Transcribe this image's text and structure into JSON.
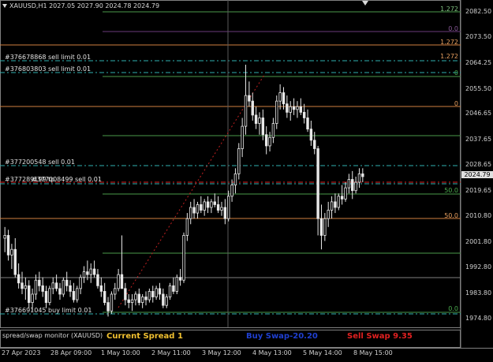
{
  "window": {
    "symbol_line": "XAUUSD,H1  2027.05 2027.90 2024.78 2024.79"
  },
  "orders": [
    {
      "label": "#376678868 sell limit 0.01"
    },
    {
      "label": "#376803803 sell limit 0.01"
    },
    {
      "label": "#377200548 sell 0.01"
    },
    {
      "label": "#377289199 tp"
    },
    {
      "label": "#377008499 sell 0.01"
    },
    {
      "label": "#376691045 buy limit 0.01"
    }
  ],
  "fib_levels": [
    {
      "text": "1.272",
      "color": "#7fbf7f"
    },
    {
      "text": "0.0",
      "color": "#8a5a9a"
    },
    {
      "text": "1.272",
      "color": "#e8a060"
    },
    {
      "text": "1.272",
      "color": "#e8a060"
    },
    {
      "text": "0",
      "color": "#4caf50"
    },
    {
      "text": "0",
      "color": "#e8a060"
    },
    {
      "text": "50.0",
      "color": "#4caf50"
    },
    {
      "text": "50.0",
      "color": "#e8a060"
    },
    {
      "text": "0.0",
      "color": "#4caf50"
    }
  ],
  "price_axis": [
    "2082.50",
    "2073.50",
    "2064.25",
    "2055.50",
    "2046.65",
    "2037.65",
    "2028.65",
    "2019.65",
    "2010.80",
    "2001.80",
    "1992.80",
    "1983.80",
    "1974.80"
  ],
  "current_price": "2024.79",
  "time_axis": [
    "27 Apr 2023",
    "28 Apr 09:00",
    "1 May 10:00",
    "2 May 11:00",
    "3 May 12:00",
    "4 May 13:00",
    "5 May 14:00",
    "8 May 15:00"
  ],
  "subwindow": {
    "title": "spread/swap monitor (XAUUSD)",
    "spread_label": "Current Spread 1",
    "buy_swap_label": "Buy Swap-20.20",
    "sell_swap_label": "Sell Swap 9.35",
    "spread_color": "#f0c030",
    "buy_color": "#1f3fd0",
    "sell_color": "#e02020"
  },
  "chart_data": {
    "type": "candlestick",
    "symbol": "XAUUSD",
    "timeframe": "H1",
    "ylim": [
      1972,
      2087
    ],
    "ohlc": [
      [
        2003,
        2007,
        1998,
        2004
      ],
      [
        2004,
        2006,
        1995,
        1997
      ],
      [
        1997,
        2001,
        1992,
        1999
      ],
      [
        1999,
        2003,
        1989,
        1990
      ],
      [
        1990,
        1994,
        1985,
        1987
      ],
      [
        1987,
        1991,
        1983,
        1985
      ],
      [
        1985,
        1989,
        1981,
        1986
      ],
      [
        1986,
        1988,
        1978,
        1980
      ],
      [
        1980,
        1985,
        1977,
        1983
      ],
      [
        1983,
        1990,
        1981,
        1988
      ],
      [
        1988,
        1991,
        1984,
        1986
      ],
      [
        1986,
        1989,
        1982,
        1984
      ],
      [
        1984,
        1986,
        1978,
        1980
      ],
      [
        1980,
        1986,
        1979,
        1985
      ],
      [
        1985,
        1989,
        1983,
        1987
      ],
      [
        1987,
        1990,
        1984,
        1985
      ],
      [
        1985,
        1987,
        1981,
        1983
      ],
      [
        1983,
        1989,
        1982,
        1988
      ],
      [
        1988,
        1991,
        1984,
        1986
      ],
      [
        1986,
        1988,
        1982,
        1984
      ],
      [
        1984,
        1987,
        1980,
        1981
      ],
      [
        1981,
        1986,
        1980,
        1985
      ],
      [
        1985,
        1990,
        1983,
        1989
      ],
      [
        1989,
        1993,
        1987,
        1991
      ],
      [
        1991,
        1995,
        1988,
        1990
      ],
      [
        1990,
        1994,
        1987,
        1992
      ],
      [
        1992,
        1995,
        1989,
        1990
      ],
      [
        1990,
        1992,
        1985,
        1986
      ],
      [
        1986,
        1989,
        1982,
        1984
      ],
      [
        1984,
        1987,
        1979,
        1980
      ],
      [
        1980,
        1982,
        1975,
        1977
      ],
      [
        1977,
        1984,
        1976,
        1983
      ],
      [
        1983,
        1987,
        1981,
        1985
      ],
      [
        1985,
        1992,
        1984,
        1990
      ],
      [
        1990,
        2004,
        1989,
        1985
      ],
      [
        1985,
        1987,
        1979,
        1981
      ],
      [
        1981,
        1983,
        1978,
        1980
      ],
      [
        1980,
        1983,
        1977,
        1981
      ],
      [
        1981,
        1984,
        1979,
        1983
      ],
      [
        1983,
        1985,
        1979,
        1980
      ],
      [
        1980,
        1983,
        1978,
        1982
      ],
      [
        1982,
        1984,
        1979,
        1981
      ],
      [
        1981,
        1985,
        1980,
        1984
      ],
      [
        1984,
        1986,
        1980,
        1982
      ],
      [
        1982,
        1986,
        1981,
        1985
      ],
      [
        1985,
        1987,
        1981,
        1983
      ],
      [
        1983,
        1985,
        1978,
        1979
      ],
      [
        1979,
        1983,
        1978,
        1982
      ],
      [
        1982,
        1987,
        1981,
        1986
      ],
      [
        1986,
        1989,
        1983,
        1984
      ],
      [
        1984,
        1990,
        1983,
        1989
      ],
      [
        1989,
        1992,
        1986,
        1988
      ],
      [
        1988,
        2005,
        1987,
        2004
      ],
      [
        2004,
        2012,
        2002,
        2010
      ],
      [
        2010,
        2016,
        2008,
        2014
      ],
      [
        2014,
        2017,
        2010,
        2012
      ],
      [
        2012,
        2016,
        2010,
        2015
      ],
      [
        2015,
        2018,
        2012,
        2013
      ],
      [
        2013,
        2017,
        2011,
        2016
      ],
      [
        2016,
        2018,
        2012,
        2014
      ],
      [
        2014,
        2017,
        2012,
        2016
      ],
      [
        2016,
        2019,
        2014,
        2015
      ],
      [
        2015,
        2018,
        2012,
        2013
      ],
      [
        2013,
        2016,
        2011,
        2014
      ],
      [
        2014,
        2017,
        2008,
        2010
      ],
      [
        2010,
        2020,
        2009,
        2018
      ],
      [
        2018,
        2024,
        2016,
        2022
      ],
      [
        2022,
        2028,
        2019,
        2026
      ],
      [
        2026,
        2037,
        2024,
        2035
      ],
      [
        2035,
        2046,
        2032,
        2043
      ],
      [
        2043,
        2065,
        2040,
        2054
      ],
      [
        2054,
        2059,
        2050,
        2052
      ],
      [
        2052,
        2055,
        2045,
        2047
      ],
      [
        2047,
        2050,
        2042,
        2044
      ],
      [
        2044,
        2048,
        2040,
        2046
      ],
      [
        2046,
        2049,
        2038,
        2040
      ],
      [
        2040,
        2043,
        2033,
        2036
      ],
      [
        2036,
        2041,
        2034,
        2039
      ],
      [
        2039,
        2046,
        2037,
        2044
      ],
      [
        2044,
        2054,
        2042,
        2052
      ],
      [
        2052,
        2058,
        2049,
        2055
      ],
      [
        2055,
        2057,
        2049,
        2051
      ],
      [
        2051,
        2054,
        2046,
        2048
      ],
      [
        2048,
        2052,
        2045,
        2050
      ],
      [
        2050,
        2053,
        2047,
        2049
      ],
      [
        2049,
        2052,
        2046,
        2050
      ],
      [
        2050,
        2053,
        2047,
        2048
      ],
      [
        2048,
        2051,
        2044,
        2046
      ],
      [
        2046,
        2049,
        2041,
        2042
      ],
      [
        2042,
        2045,
        2036,
        2038
      ],
      [
        2038,
        2041,
        2033,
        2035
      ],
      [
        2035,
        2036,
        2004,
        2010
      ],
      [
        2010,
        2015,
        1999,
        2004
      ],
      [
        2004,
        2012,
        2002,
        2010
      ],
      [
        2010,
        2016,
        2007,
        2013
      ],
      [
        2013,
        2018,
        2010,
        2016
      ],
      [
        2016,
        2019,
        2012,
        2014
      ],
      [
        2014,
        2019,
        2013,
        2018
      ],
      [
        2018,
        2022,
        2015,
        2017
      ],
      [
        2017,
        2023,
        2016,
        2021
      ],
      [
        2021,
        2026,
        2019,
        2024
      ],
      [
        2024,
        2027,
        2017,
        2020
      ],
      [
        2020,
        2025,
        2019,
        2023
      ],
      [
        2023,
        2028,
        2021,
        2026
      ],
      [
        2026,
        2028,
        2023,
        2025
      ]
    ]
  }
}
